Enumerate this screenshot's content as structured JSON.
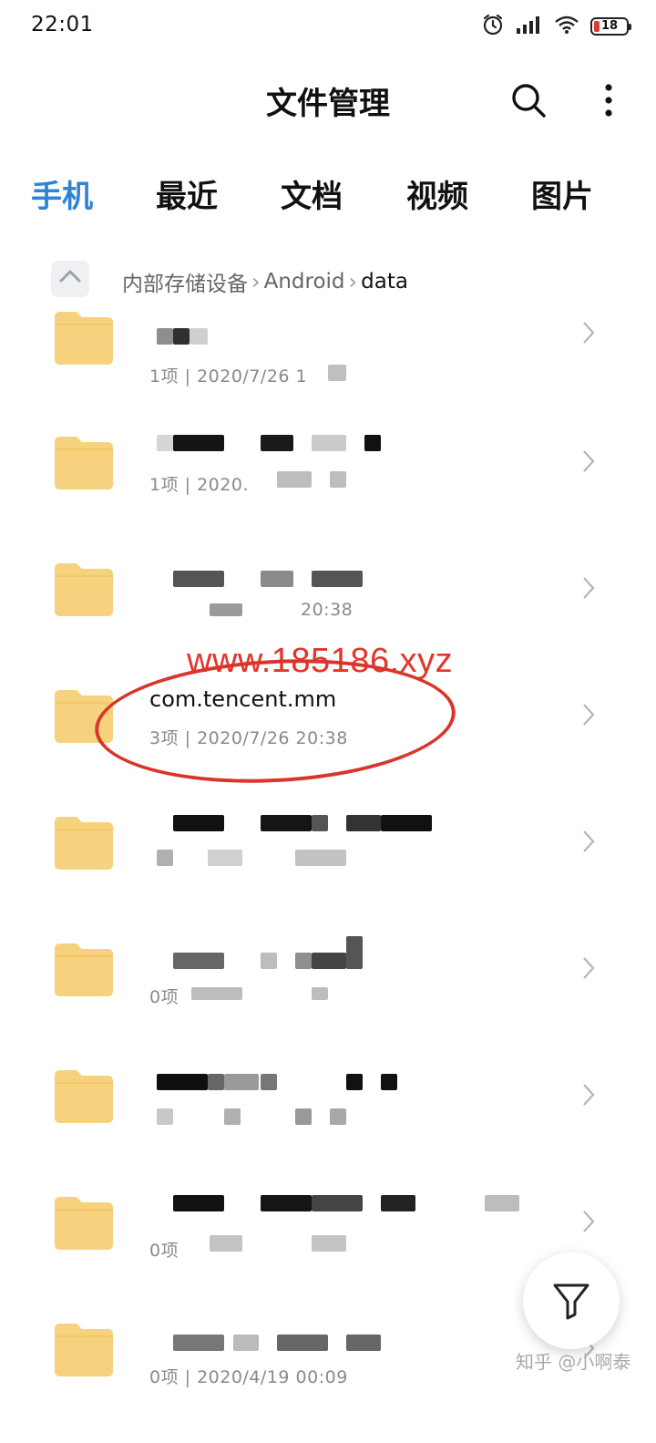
{
  "status_bar": {
    "time": "22:01",
    "battery": "18",
    "icons": [
      "alarm-icon",
      "signal-icon",
      "wifi-icon",
      "battery-icon"
    ]
  },
  "header": {
    "title": "文件管理",
    "search_icon": "search-icon",
    "more_icon": "more-vertical-icon"
  },
  "tabs": [
    {
      "label": "手机",
      "active": true
    },
    {
      "label": "最近",
      "active": false
    },
    {
      "label": "文档",
      "active": false
    },
    {
      "label": "视频",
      "active": false
    },
    {
      "label": "图片",
      "active": false
    }
  ],
  "breadcrumb": {
    "items": [
      "内部存储设备",
      "Android",
      "data"
    ],
    "up_icon": "up-arrow-icon"
  },
  "files": [
    {
      "name": "",
      "meta": "1项 | 2020/7/26 1"
    },
    {
      "name": "",
      "meta": "1项 | 2020."
    },
    {
      "name": "",
      "meta": "20:38"
    },
    {
      "name": "com.tencent.mm",
      "meta": "3项 | 2020/7/26 20:38"
    },
    {
      "name": "",
      "meta": ""
    },
    {
      "name": "",
      "meta": "0项"
    },
    {
      "name": "",
      "meta": ""
    },
    {
      "name": "",
      "meta": "0项"
    },
    {
      "name": "",
      "meta": "0项 | 2020/4/19 00:09"
    }
  ],
  "annotation": {
    "watermark_text": "www.185186.xyz",
    "color": "#e2362b"
  },
  "fab": {
    "icon": "filter-icon"
  },
  "footer_watermark": "知乎 @小啊泰",
  "colors": {
    "accent": "#2e83d6",
    "folder": "#f7d27e",
    "folder_tab": "#f3c766"
  }
}
